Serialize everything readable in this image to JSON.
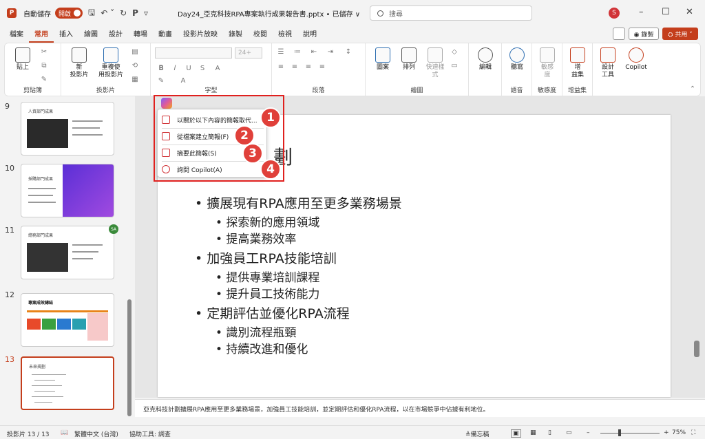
{
  "titlebar": {
    "app_letter": "P",
    "autosave_label": "自動儲存",
    "autosave_state": "開啟",
    "file_title": "Day24_亞克科技RPA專案執行成果報告書.pptx • 已儲存 ∨",
    "search_placeholder": "搜尋",
    "user_initial": "S",
    "qa_save": "🖫",
    "qa_undo": "↶ ˅",
    "qa_redo": "↻",
    "qa_present": "𝗣",
    "qa_more": "▿"
  },
  "menu": [
    "檔案",
    "常用",
    "插入",
    "繪圖",
    "設計",
    "轉場",
    "動畫",
    "投影片放映",
    "錄製",
    "校閱",
    "檢視",
    "說明"
  ],
  "menu_active": 1,
  "record_label": "◉ 錄製",
  "share_label": "⛭ 共用 ˅",
  "ribbon": {
    "paste": "貼上",
    "clipboard_group": "剪貼簿",
    "new_slide": "新\n投影片",
    "reuse_slide": "重複使\n用投影片",
    "slides_group": "投影片",
    "font_size": "24+",
    "font_group": "字型",
    "paragraph_group": "段落",
    "shapes": "圖案",
    "arrange": "排列",
    "quick_styles": "快速樣\n式",
    "drawing_group": "繪圖",
    "editing": "編輯",
    "dictate": "聽寫",
    "voice_group": "語音",
    "sensitivity": "敏感\n度",
    "sensitivity_group": "敏感度",
    "addins": "增\n益集",
    "addins_group": "增益集",
    "designer": "設計\n工具",
    "copilot": "Copilot"
  },
  "thumbnails": [
    {
      "num": "9",
      "title": "人資部門成果"
    },
    {
      "num": "10",
      "title": "採購部門成果"
    },
    {
      "num": "11",
      "title": "總務部門成果",
      "badge": "SA"
    },
    {
      "num": "12",
      "title": "專案成效總結"
    },
    {
      "num": "13",
      "title": "未來規劃"
    }
  ],
  "slide": {
    "title_fragment": "劃",
    "bullets": [
      {
        "level": 1,
        "text": "• 擴展現有RPA應用至更多業務場景"
      },
      {
        "level": 2,
        "text": "• 探索新的應用領域"
      },
      {
        "level": 2,
        "text": "• 提高業務效率"
      },
      {
        "level": 1,
        "text": "• 加強員工RPA技能培訓"
      },
      {
        "level": 2,
        "text": "• 提供專業培訓課程"
      },
      {
        "level": 2,
        "text": "• 提升員工技術能力"
      },
      {
        "level": 1,
        "text": "• 定期評估並優化RPA流程"
      },
      {
        "level": 2,
        "text": "• 識別流程瓶頸"
      },
      {
        "level": 2,
        "text": "• 持續改進和優化"
      }
    ]
  },
  "copilot_menu": [
    {
      "label": "以關於以下內容的簡報取代...",
      "marker": "1"
    },
    {
      "label": "從檔案建立簡報(F)",
      "marker": "2"
    },
    {
      "label": "摘要此簡報(S)",
      "marker": "3"
    },
    {
      "label": "詢問 Copilot(A)",
      "marker": "4"
    }
  ],
  "notes": "亞克科技計劃擴展RPA應用至更多業務場景，加強員工技能培訓，並定期評估和優化RPA流程，以在市場競爭中佔據有利地位。",
  "status": {
    "slide_count": "投影片 13 / 13",
    "language": "繁體中文 (台灣)",
    "accessibility": "協助工具: 調查",
    "notes_btn": "≜備忘稿",
    "zoom": "75%"
  }
}
